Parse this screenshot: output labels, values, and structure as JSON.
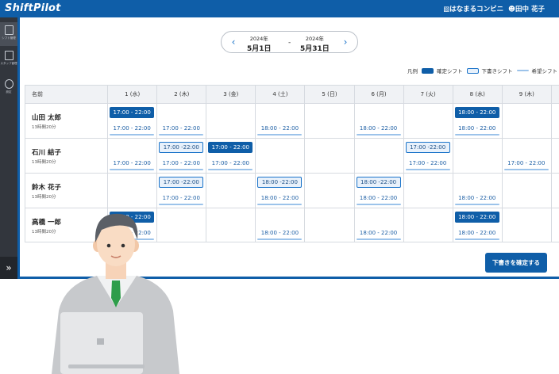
{
  "app": {
    "brand": "ShiftPilot",
    "store": "はなまるコンビニ",
    "user": "田中 花子"
  },
  "colors": {
    "primary": "#0f5ea8",
    "draft_fill": "#e8f1fb",
    "wish_line": "#9cc3ea",
    "sidebar": "#32363d"
  },
  "sidebar": {
    "items": [
      {
        "icon": "calendar-icon",
        "label": "シフト管理"
      },
      {
        "icon": "staff-list-icon",
        "label": "スタッフ管理"
      },
      {
        "icon": "gear-icon",
        "label": "設定"
      }
    ],
    "expand_label": "»"
  },
  "period": {
    "start_year": "2024年",
    "start_date": "5月1日",
    "separator": "-",
    "end_year": "2024年",
    "end_date": "5月31日",
    "prev_label": "‹",
    "next_label": "›"
  },
  "legend": {
    "title": "凡例",
    "confirmed": "確定シフト",
    "draft": "下書きシフト",
    "wish": "希望シフト"
  },
  "table": {
    "name_header": "名前",
    "days": [
      "1 (水)",
      "2 (木)",
      "3 (金)",
      "4 (土)",
      "5 (日)",
      "6 (月)",
      "7 (火)",
      "8 (水)",
      "9 (木)"
    ],
    "rows": [
      {
        "name": "山田 太郎",
        "hours": "13時間20分",
        "cells": [
          {
            "confirmed": "17:00 - 22:00",
            "wish": "17:00 - 22:00"
          },
          {
            "wish": "17:00 - 22:00"
          },
          {},
          {
            "wish": "18:00 - 22:00"
          },
          {},
          {
            "wish": "18:00 - 22:00"
          },
          {},
          {
            "confirmed": "18:00 - 22:00",
            "wish": "18:00 - 22:00"
          },
          {}
        ]
      },
      {
        "name": "石川 結子",
        "hours": "13時間20分",
        "cells": [
          {
            "wish": "17:00 - 22:00"
          },
          {
            "draft": "17:00 -22:00",
            "wish": "17:00 - 22:00"
          },
          {
            "confirmed": "17:00 - 22:00",
            "wish": "17:00 - 22:00"
          },
          {},
          {},
          {},
          {
            "draft": "17:00 -22:00",
            "wish": "17:00 - 22:00"
          },
          {},
          {
            "wish": "17:00 - 22:00"
          }
        ]
      },
      {
        "name": "鈴木 花子",
        "hours": "13時間20分",
        "cells": [
          {},
          {
            "draft": "17:00 -22:00",
            "wish": "17:00 - 22:00"
          },
          {},
          {
            "draft": "18:00 -22:00",
            "wish": "18:00 - 22:00"
          },
          {},
          {
            "draft": "18:00 -22:00",
            "wish": "18:00 - 22:00"
          },
          {},
          {
            "wish": "18:00 - 22:00"
          },
          {}
        ]
      },
      {
        "name": "高橋 一郎",
        "hours": "13時間20分",
        "cells": [
          {
            "confirmed": "17:00 - 22:00",
            "wish": "17:00 - 22:00"
          },
          {},
          {},
          {
            "wish": "18:00 - 22:00"
          },
          {},
          {
            "wish": "18:00 - 22:00"
          },
          {},
          {
            "confirmed": "18:00 - 22:00",
            "wish": "18:00 - 22:00"
          },
          {}
        ]
      }
    ]
  },
  "actions": {
    "confirm_drafts": "下書きを確定する"
  },
  "illustration": {
    "subject": "person-with-laptop"
  }
}
